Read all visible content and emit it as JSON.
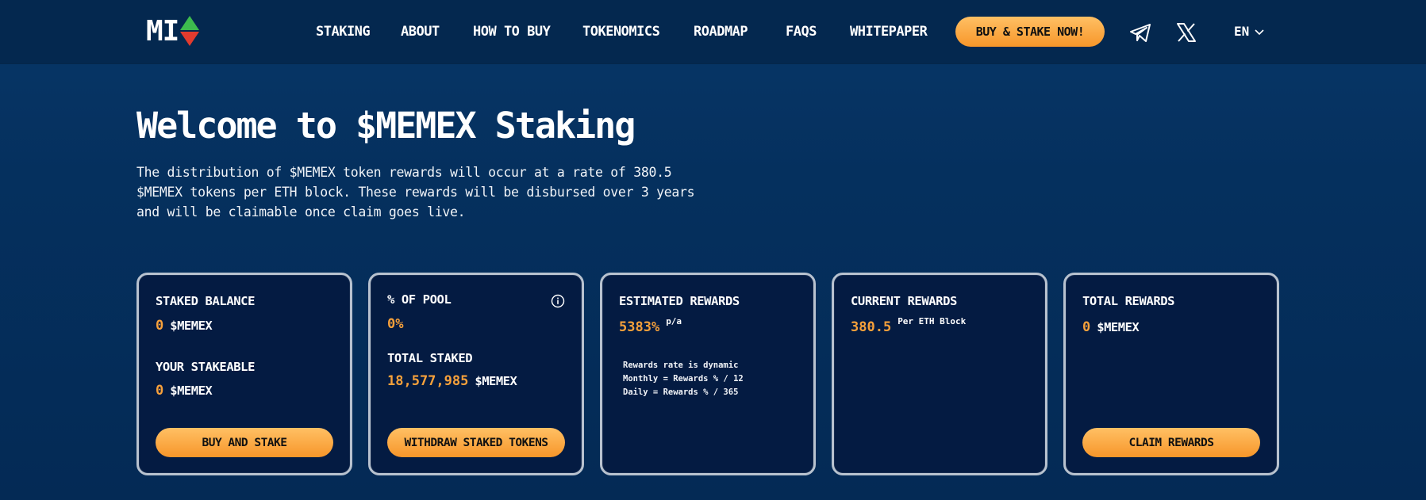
{
  "header": {
    "logo_text": "MI",
    "nav": [
      "STAKING",
      "ABOUT",
      "HOW TO BUY",
      "TOKENOMICS",
      "ROADMAP",
      "FAQS",
      "WHITEPAPER"
    ],
    "cta_label": "BUY & STAKE NOW!",
    "social": [
      "telegram-icon",
      "x-icon"
    ],
    "language": "EN"
  },
  "hero": {
    "title": "Welcome to $MEMEX Staking",
    "description": "The distribution of $MEMEX token rewards will occur at a rate of 380.5 $MEMEX tokens per ETH block. These rewards will be disbursed over 3 years and will be claimable once claim goes live."
  },
  "cards": {
    "staked": {
      "label": "STAKED BALANCE",
      "value": "0",
      "unit": "$MEMEX",
      "stakeable_label": "YOUR STAKEABLE",
      "stakeable_value": "0",
      "stakeable_unit": "$MEMEX",
      "button": "BUY AND STAKE"
    },
    "pool": {
      "label": "% OF POOL",
      "value": "0%",
      "total_label": "TOTAL STAKED",
      "total_value": "18,577,985",
      "total_unit": "$MEMEX",
      "button": "WITHDRAW STAKED TOKENS"
    },
    "estimated": {
      "label": "ESTIMATED REWARDS",
      "value": "5383%",
      "suffix": "p/a",
      "notes": [
        "Rewards rate is dynamic",
        "Monthly = Rewards % / 12",
        "Daily = Rewards % / 365"
      ]
    },
    "current": {
      "label": "CURRENT REWARDS",
      "value": "380.5",
      "suffix": "Per ETH Block"
    },
    "total": {
      "label": "TOTAL REWARDS",
      "value": "0",
      "unit": "$MEMEX",
      "button": "CLAIM REWARDS"
    }
  },
  "colors": {
    "accent": "#f7a13b",
    "background": "#05305e",
    "card_bg": "#041b42",
    "card_border": "#b8c2cf"
  }
}
